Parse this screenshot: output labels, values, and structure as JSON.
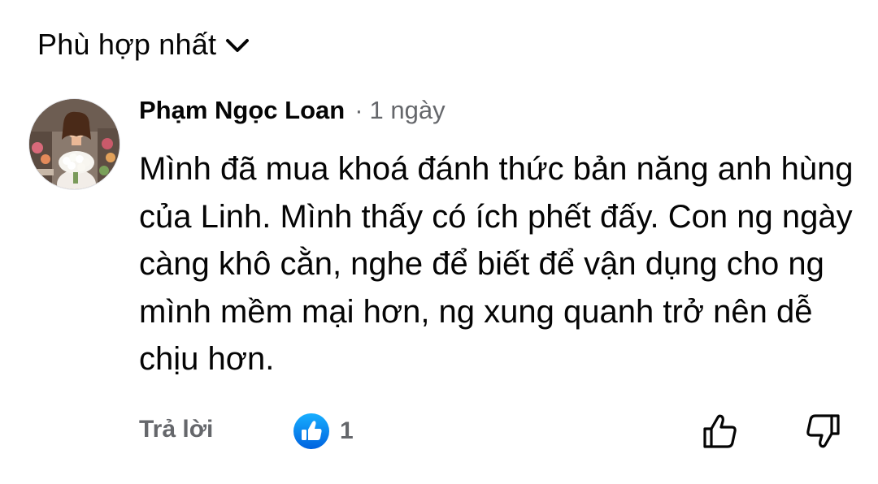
{
  "sort": {
    "label": "Phù hợp nhất"
  },
  "comment": {
    "author": "Phạm Ngọc Loan",
    "separator": "·",
    "time": "1 ngày",
    "text": "Mình đã mua khoá đánh thức bản năng anh hùng của Linh. Mình thấy có ích phết đấy. Con ng ngày càng khô cằn, nghe để biết để vận dụng cho ng mình mềm mại hơn, ng xung quanh trở nên dễ chịu hơn."
  },
  "actions": {
    "reply_label": "Trả lời",
    "reaction_count": "1"
  },
  "icons": {
    "sort_chevron": "chevron-down-icon",
    "reaction": "like-reaction-icon",
    "like": "thumbs-up-icon",
    "dislike": "thumbs-down-icon"
  },
  "colors": {
    "text_primary": "#050505",
    "text_secondary": "#65676b",
    "like_blue": "#1877f2"
  }
}
